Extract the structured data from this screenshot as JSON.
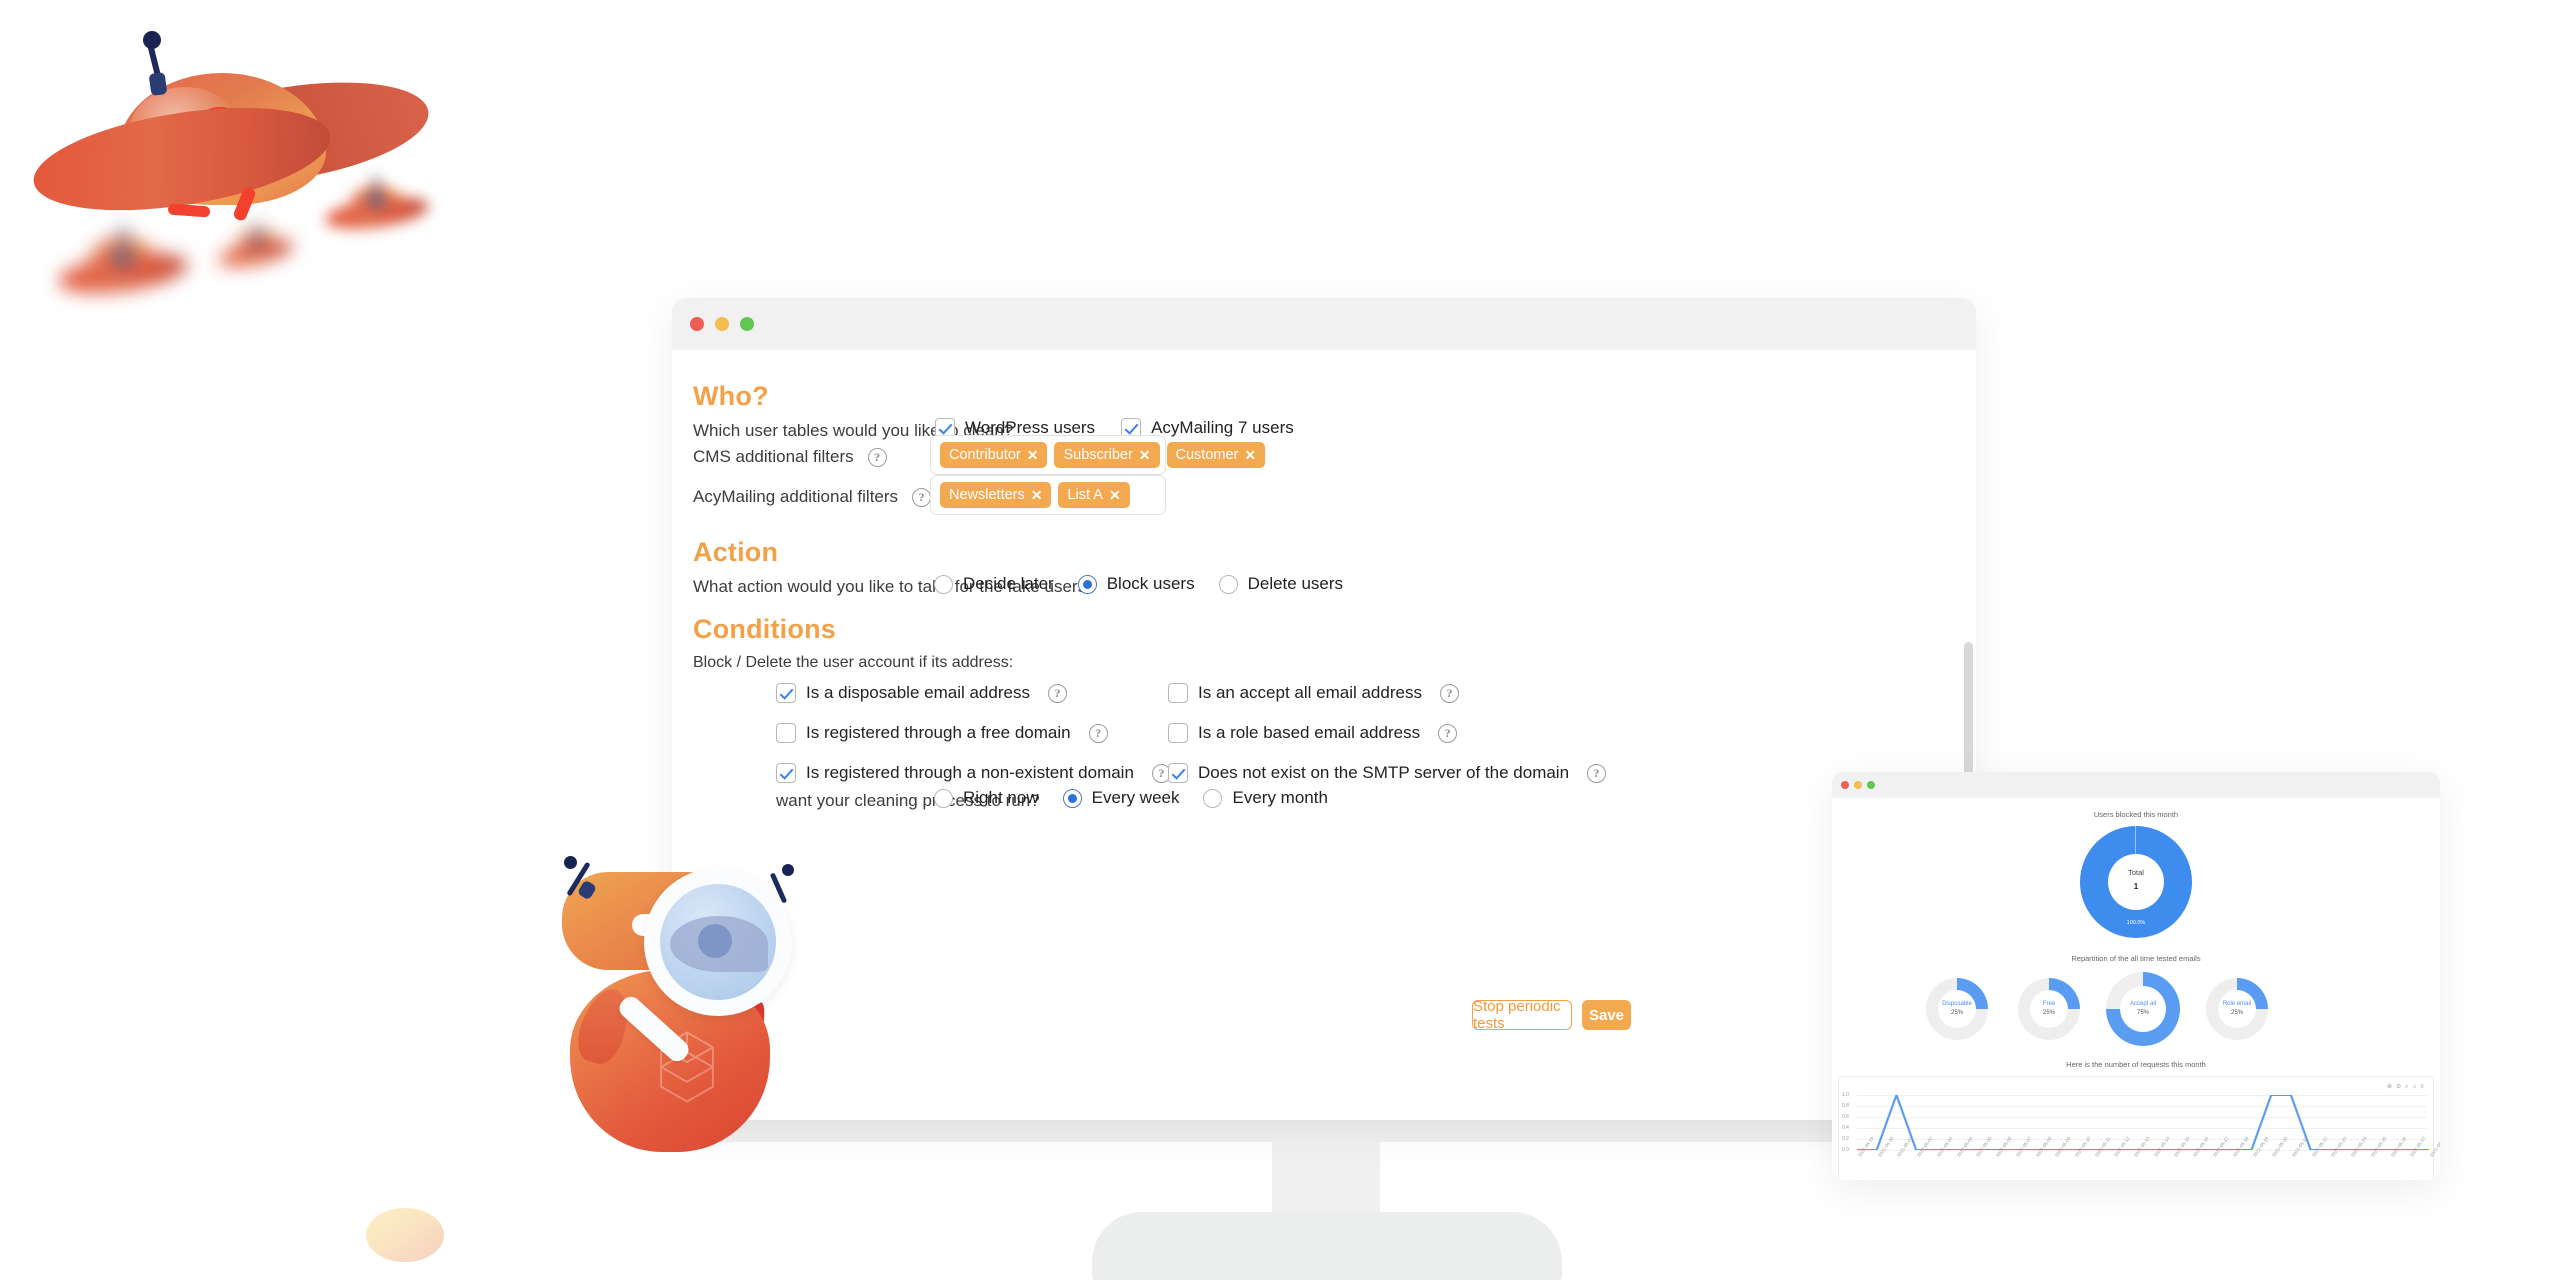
{
  "main_window": {
    "traffic_lights": [
      "close-red",
      "minimize-yellow",
      "maximize-green"
    ],
    "sections": {
      "who": {
        "title": "Who?",
        "tables_question": "Which user tables would you like to clean?",
        "tables_options": [
          {
            "label": "WordPress users",
            "checked": true
          },
          {
            "label": "AcyMailing 7 users",
            "checked": true
          }
        ],
        "cms_filters_label": "CMS additional filters",
        "cms_filters_help": "?",
        "cms_filters_tags": [
          "Contributor",
          "Subscriber",
          "Customer"
        ],
        "acy_filters_label": "AcyMailing additional filters",
        "acy_filters_help": "?",
        "acy_filters_tags": [
          "Newsletters",
          "List A"
        ]
      },
      "action": {
        "title": "Action",
        "question": "What action would you like to take for the fake users?",
        "options": [
          {
            "label": "Decide later",
            "selected": false
          },
          {
            "label": "Block users",
            "selected": true
          },
          {
            "label": "Delete users",
            "selected": false
          }
        ]
      },
      "conditions": {
        "title": "Conditions",
        "intro": "Block / Delete the user account if its address:",
        "left_column": [
          {
            "label": "Is a disposable email address",
            "checked": true,
            "help": "?"
          },
          {
            "label": "Is registered through a free domain",
            "checked": false,
            "help": "?"
          },
          {
            "label": "Is registered through a non-existent domain",
            "checked": true,
            "help": "?"
          }
        ],
        "right_column": [
          {
            "label": "Is an accept all email address",
            "checked": false,
            "help": "?"
          },
          {
            "label": "Is a role based email address",
            "checked": false,
            "help": "?"
          },
          {
            "label": "Does not exist on the SMTP server of the domain",
            "checked": true,
            "help": "?"
          }
        ]
      },
      "schedule": {
        "question": "want your cleaning process to run?",
        "options": [
          {
            "label": "Right now",
            "selected": false
          },
          {
            "label": "Every week",
            "selected": true
          },
          {
            "label": "Every month",
            "selected": false
          }
        ]
      }
    },
    "buttons": {
      "stop_periodic": "Stop periodic tests",
      "save": "Save"
    }
  },
  "dashboard_window": {
    "traffic_lights": [
      "close-red",
      "minimize-yellow",
      "maximize-green"
    ],
    "blocked_title": "Users blocked this month",
    "repartition_title": "Repartition of the all time tested emails",
    "requests_title": "Here is the number of requests this month",
    "toolbar_icons": "⊕ ⊖ ⌕ ⌂ ≡"
  },
  "chart_data": [
    {
      "type": "pie",
      "title": "Users blocked this month",
      "center_label": "Total",
      "center_value": "1",
      "slice_label": "100.0%",
      "categories": [
        "Blocked"
      ],
      "values": [
        100.0
      ],
      "colors": [
        "#3e8ced"
      ]
    },
    {
      "type": "pie",
      "title": "Repartition of the all time tested emails",
      "categories": [
        "Disposable",
        "Free",
        "Accept all",
        "Role email"
      ],
      "values": [
        25,
        25,
        75,
        25
      ],
      "labels": [
        "25%",
        "25%",
        "75%",
        "25%"
      ],
      "colors": [
        "#5a9cf2",
        "#5a9cf2",
        "#5a9cf2",
        "#5a9cf2"
      ],
      "track_color": "#eeeeee"
    },
    {
      "type": "line",
      "title": "Here is the number of requests this month",
      "ylabel": "",
      "xlabel": "",
      "ylim": [
        0,
        1.0
      ],
      "yticks": [
        "1.0",
        "0.8",
        "0.6",
        "0.4",
        "0.2",
        "0.0"
      ],
      "grid": true,
      "legend": "none",
      "line_color": "#5a9cf2",
      "x": [
        "2021-04-29",
        "2021-04-30",
        "2021-05-01",
        "2021-05-02",
        "2021-05-03",
        "2021-05-04",
        "2021-05-05",
        "2021-05-06",
        "2021-05-07",
        "2021-05-08",
        "2021-05-09",
        "2021-05-10",
        "2021-05-11",
        "2021-05-12",
        "2021-05-13",
        "2021-05-14",
        "2021-05-15",
        "2021-05-16",
        "2021-05-17",
        "2021-05-18",
        "2021-05-19",
        "2021-05-20",
        "2021-05-21",
        "2021-05-22",
        "2021-05-23",
        "2021-05-24",
        "2021-05-25",
        "2021-05-26",
        "2021-05-27",
        "2021-05-28"
      ],
      "values": [
        0,
        0,
        1,
        0,
        0,
        0,
        0,
        0,
        0,
        0,
        0,
        0,
        0,
        0,
        0,
        0,
        0,
        0,
        0,
        0,
        0,
        1,
        1,
        0,
        0,
        0,
        0,
        0,
        0,
        0
      ]
    }
  ],
  "illustrations": {
    "ufo_large": "ufo-spaceship",
    "ufo_small_blurred": [
      "ufo-small-1",
      "ufo-small-2",
      "ufo-small-3"
    ],
    "mascot": "alien-mascot-with-magnifier",
    "egg": "egg-shape"
  }
}
